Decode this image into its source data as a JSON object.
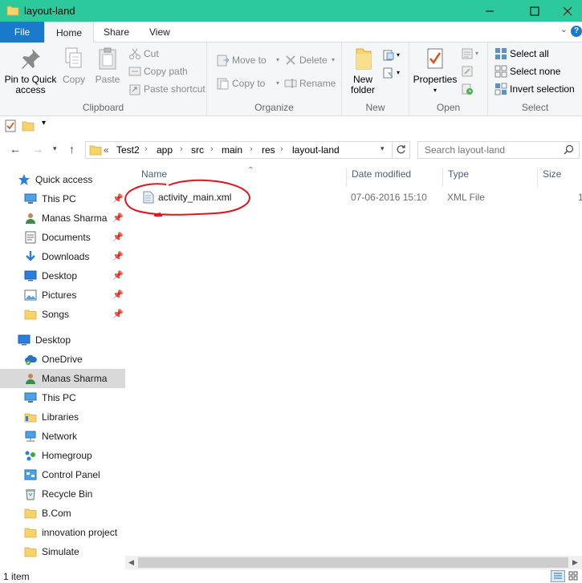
{
  "window": {
    "title": "layout-land"
  },
  "ribbon_tabs": [
    "File",
    "Home",
    "Share",
    "View"
  ],
  "ribbon": {
    "clipboard": {
      "pin_label_1": "Pin to Quick",
      "pin_label_2": "access",
      "copy": "Copy",
      "paste": "Paste",
      "cut": "Cut",
      "copy_path": "Copy path",
      "paste_shortcut": "Paste shortcut",
      "group": "Clipboard"
    },
    "organize": {
      "move_to": "Move to",
      "copy_to": "Copy to",
      "delete": "Delete",
      "rename": "Rename",
      "group": "Organize"
    },
    "new": {
      "new_folder_1": "New",
      "new_folder_2": "folder",
      "group": "New"
    },
    "open": {
      "properties": "Properties",
      "group": "Open"
    },
    "select": {
      "select_all": "Select all",
      "select_none": "Select none",
      "invert_selection": "Invert selection",
      "group": "Select"
    }
  },
  "address": {
    "overflow": "«",
    "crumbs": [
      "Test2",
      "app",
      "src",
      "main",
      "res",
      "layout-land"
    ]
  },
  "search": {
    "placeholder": "Search layout-land"
  },
  "nav": {
    "quick_access": "Quick access",
    "quick_items": [
      "This PC",
      "Manas Sharma",
      "Documents",
      "Downloads",
      "Desktop",
      "Pictures",
      "Songs"
    ],
    "desktop": "Desktop",
    "desktop_items": [
      "OneDrive",
      "Manas Sharma",
      "This PC",
      "Libraries",
      "Network",
      "Homegroup",
      "Control Panel",
      "Recycle Bin",
      "B.Com",
      "innovation project",
      "Simulate"
    ]
  },
  "columns": {
    "name": "Name",
    "date_modified": "Date modified",
    "type": "Type",
    "size": "Size"
  },
  "files": [
    {
      "name": "activity_main.xml",
      "date_modified": "07-06-2016 15:10",
      "type": "XML File",
      "size": "1"
    }
  ],
  "status": {
    "item_count": "1 item"
  },
  "colors": {
    "titlebar": "#2bc99b",
    "file_tab": "#1979ca",
    "annotation": "#e0141e"
  }
}
